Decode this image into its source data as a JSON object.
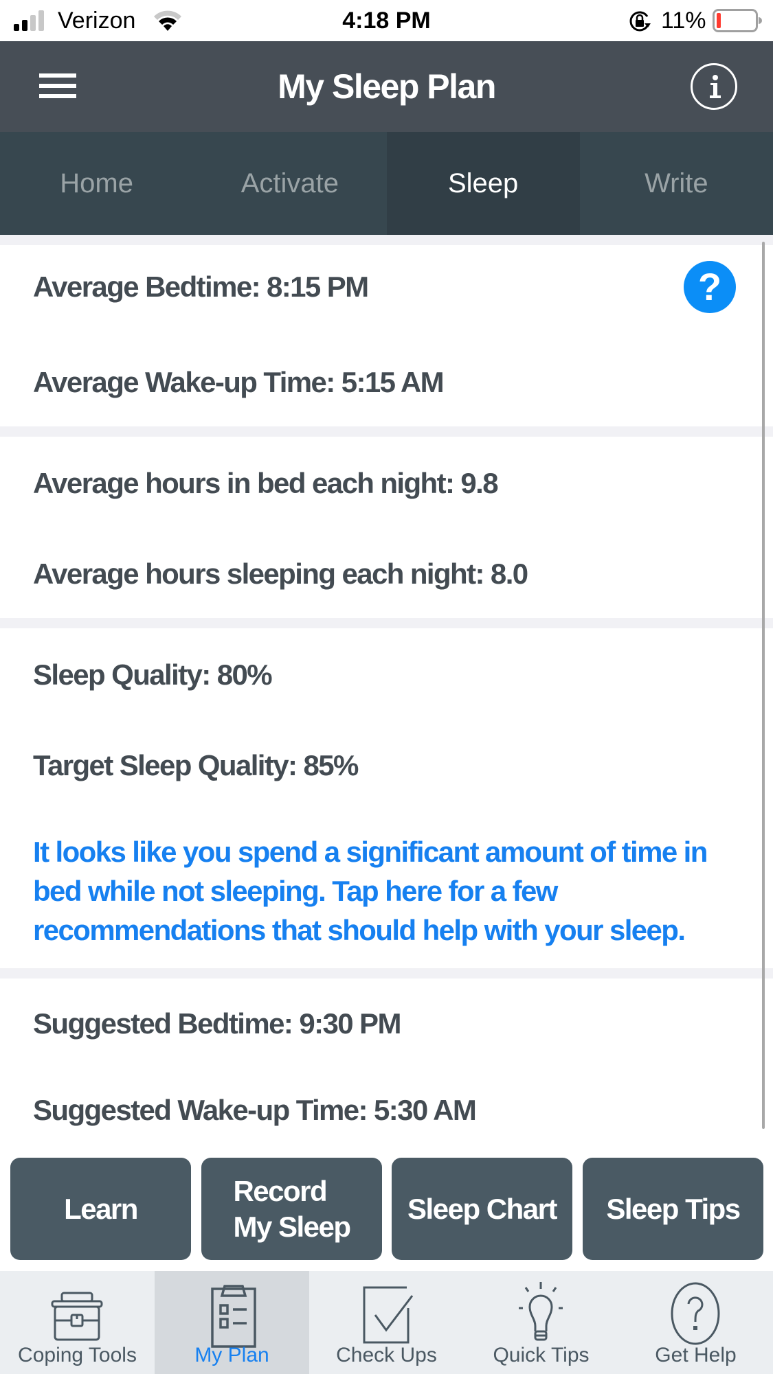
{
  "status_bar": {
    "carrier": "Verizon",
    "time": "4:18 PM",
    "battery_percent": "11%",
    "icons": [
      "signal-icon",
      "wifi-icon",
      "orientation-lock-icon",
      "battery-icon"
    ]
  },
  "header": {
    "title": "My Sleep Plan",
    "menu_icon": "hamburger-menu-icon",
    "info_icon": "info-icon"
  },
  "segment_tabs": [
    {
      "label": "Home",
      "active": false
    },
    {
      "label": "Activate",
      "active": false
    },
    {
      "label": "Sleep",
      "active": true
    },
    {
      "label": "Write",
      "active": false
    }
  ],
  "sleep_summary": {
    "average_bedtime": "Average Bedtime: 8:15 PM",
    "average_wakeup": "Average Wake-up Time: 5:15 AM",
    "hours_in_bed": "Average hours in bed each night: 9.8",
    "hours_sleeping": "Average hours sleeping each night: 8.0",
    "sleep_quality": "Sleep Quality: 80%",
    "target_sleep_quality": "Target Sleep Quality: 85%",
    "advice_link": "It looks like you spend a significant amount of time in bed while not sleeping. Tap here for a few recommendations that should help with your sleep.",
    "suggested_bedtime": "Suggested Bedtime: 9:30 PM",
    "suggested_wakeup": "Suggested Wake-up Time: 5:30 AM",
    "help_icon_label": "?"
  },
  "action_buttons": [
    {
      "label": "Learn"
    },
    {
      "label": "Record\nMy Sleep"
    },
    {
      "label": "Sleep Chart"
    },
    {
      "label": "Sleep Tips"
    }
  ],
  "bottom_nav": [
    {
      "label": "Coping Tools",
      "icon": "toolbox-icon",
      "active": false
    },
    {
      "label": "My Plan",
      "icon": "clipboard-checklist-icon",
      "active": true
    },
    {
      "label": "Check Ups",
      "icon": "checkbox-icon",
      "active": false
    },
    {
      "label": "Quick Tips",
      "icon": "lightbulb-icon",
      "active": false
    },
    {
      "label": "Get Help",
      "icon": "question-circle-icon",
      "active": false
    }
  ],
  "colors": {
    "header_bg": "#474e56",
    "tab_bg": "#37474f",
    "tab_active_bg": "#313e46",
    "text_dark": "#434b52",
    "link_blue": "#1680f0",
    "help_blue": "#0b8ef7",
    "button_bg": "#4a5a64",
    "nav_bg": "#ebeef1",
    "nav_active_bg": "#d5d9dd"
  }
}
